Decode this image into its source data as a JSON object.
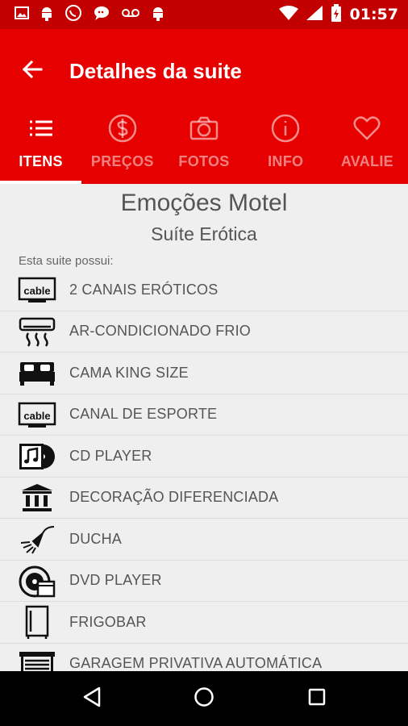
{
  "status_bar": {
    "time": "01:57",
    "left_icons": [
      "image-icon",
      "android-icon",
      "whatsapp-icon",
      "chat-icon",
      "voicemail-icon",
      "android-icon"
    ],
    "right_icons": [
      "wifi-icon",
      "cell-signal-icon",
      "battery-charging-icon"
    ]
  },
  "app_bar": {
    "title": "Detalhes da suite"
  },
  "tabs": [
    {
      "label": "ITENS",
      "icon": "list-icon",
      "active": true
    },
    {
      "label": "PREÇOS",
      "icon": "dollar-icon",
      "active": false
    },
    {
      "label": "FOTOS",
      "icon": "camera-icon",
      "active": false
    },
    {
      "label": "INFO",
      "icon": "info-icon",
      "active": false
    },
    {
      "label": "AVALIE",
      "icon": "heart-icon",
      "active": false
    }
  ],
  "content": {
    "motel_name": "Emoções Motel",
    "suite_name": "Suíte Erótica",
    "intro": "Esta suite possui:",
    "items": [
      {
        "label": "2 CANAIS ERÓTICOS",
        "icon": "cable-tv-icon",
        "icon_text": "cable"
      },
      {
        "label": "AR-CONDICIONADO FRIO",
        "icon": "air-conditioner-icon"
      },
      {
        "label": "CAMA KING SIZE",
        "icon": "bed-icon"
      },
      {
        "label": "CANAL DE ESPORTE",
        "icon": "cable-tv-icon",
        "icon_text": "cable"
      },
      {
        "label": "CD PLAYER",
        "icon": "cd-music-icon"
      },
      {
        "label": "DECORAÇÃO DIFERENCIADA",
        "icon": "building-columns-icon"
      },
      {
        "label": "DUCHA",
        "icon": "shower-icon"
      },
      {
        "label": "DVD PLAYER",
        "icon": "dvd-icon"
      },
      {
        "label": "FRIGOBAR",
        "icon": "minibar-icon"
      },
      {
        "label": "GARAGEM PRIVATIVA AUTOMÁTICA",
        "icon": "garage-icon"
      }
    ]
  },
  "colors": {
    "status_bar": "#c20000",
    "app_bar": "#e60000",
    "background": "#efefef",
    "text": "#555555"
  }
}
